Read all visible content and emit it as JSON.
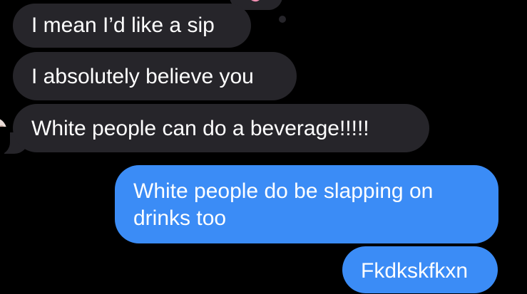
{
  "conversation": {
    "messages": [
      {
        "text": "I mean I’d like a sip",
        "direction": "incoming"
      },
      {
        "text": "I absolutely believe you",
        "direction": "incoming"
      },
      {
        "text": "White people can do a beverage!!!!!",
        "direction": "incoming"
      },
      {
        "text": "White people do be slapping on drinks too",
        "direction": "outgoing"
      },
      {
        "text": "Fkdkskfkxn",
        "direction": "outgoing"
      }
    ],
    "reaction_icon": "heart-tapback-icon",
    "colors": {
      "background": "#000000",
      "incoming_bubble": "#26252a",
      "outgoing_bubble": "#3b8cf6",
      "text": "#ffffff",
      "heart": "#f08fb2"
    }
  }
}
